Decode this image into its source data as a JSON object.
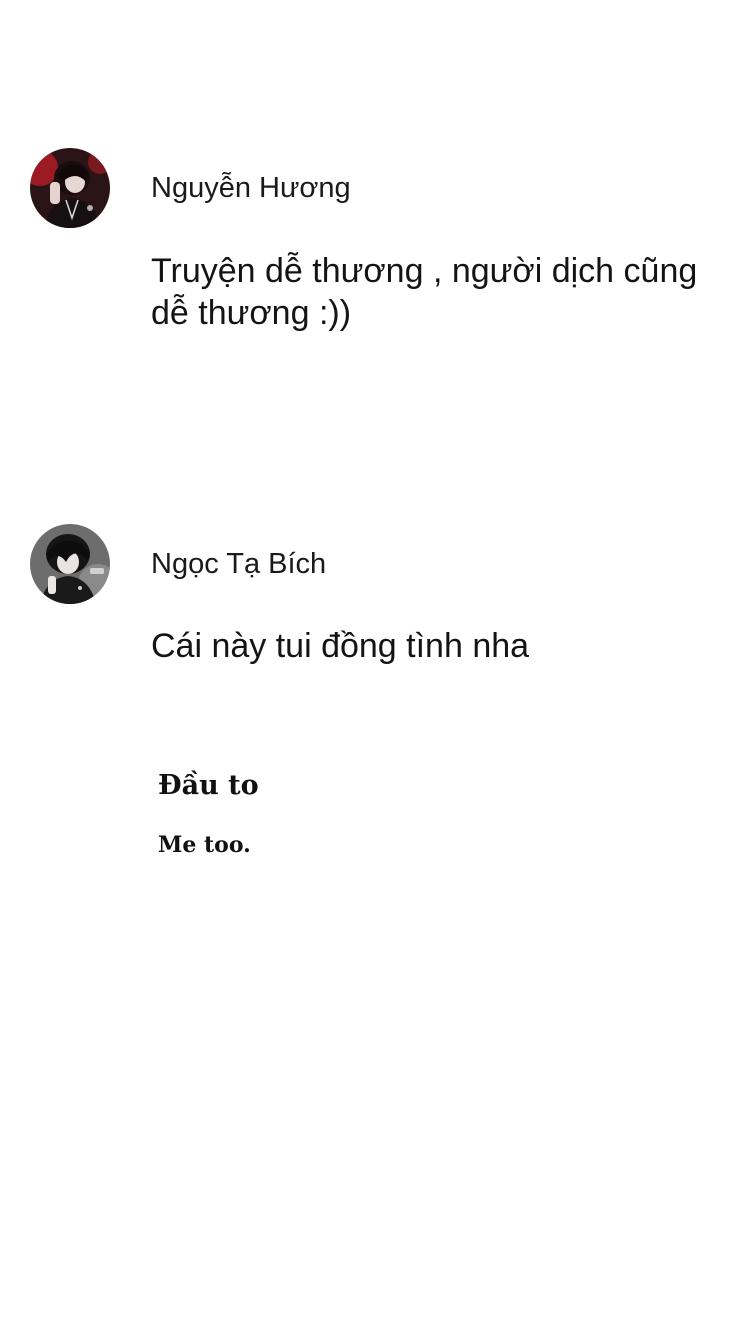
{
  "comments": [
    {
      "author": "Nguyễn Hương",
      "text": "Truyện dễ thương , người dịch cũng dễ thương :))",
      "avatar_icon": "user-avatar-dark-red"
    },
    {
      "author": "Ngọc Tạ Bích",
      "text": "Cái này tui đồng tình nha",
      "avatar_icon": "user-avatar-dark-grey"
    }
  ],
  "reply": {
    "author": "Đầu to",
    "text": "Me too."
  }
}
